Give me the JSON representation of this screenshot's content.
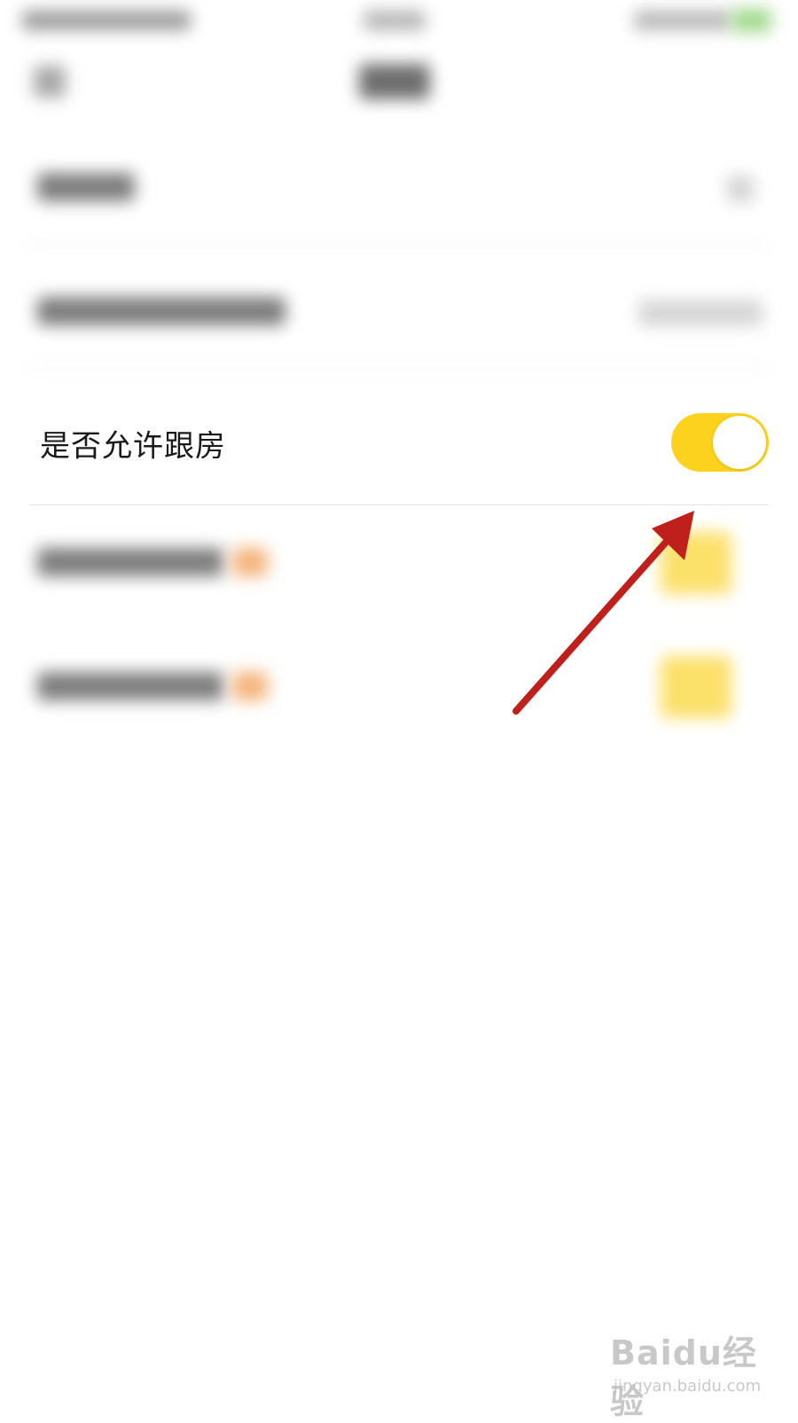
{
  "setting_row": {
    "label": "是否允许跟房",
    "toggle_on": true
  },
  "watermark": {
    "logo": "Baidu经验",
    "url": "jingyan.baidu.com"
  },
  "colors": {
    "toggle_accent": "#fdd21e",
    "arrow": "#c0201b",
    "text": "#1a1a1a"
  },
  "icons": {
    "annotation": "arrow-icon"
  }
}
